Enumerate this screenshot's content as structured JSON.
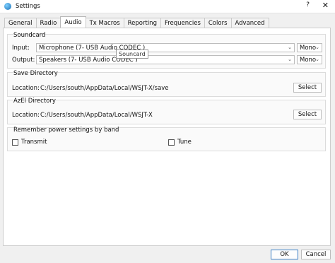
{
  "window": {
    "title": "Settings",
    "help": "?",
    "close": "✕"
  },
  "tabs": [
    {
      "label": "General"
    },
    {
      "label": "Radio"
    },
    {
      "label": "Audio"
    },
    {
      "label": "Tx Macros"
    },
    {
      "label": "Reporting"
    },
    {
      "label": "Frequencies"
    },
    {
      "label": "Colors"
    },
    {
      "label": "Advanced"
    }
  ],
  "active_tab": "Audio",
  "soundcard": {
    "title": "Soundcard",
    "input_label": "Input:",
    "input_value": "Microphone (7- USB Audio CODEC )",
    "input_channel": "Mono",
    "output_label": "Output:",
    "output_value": "Speakers (7- USB Audio CODEC )",
    "output_channel": "Mono",
    "tooltip": "Souncard"
  },
  "save_directory": {
    "title": "Save Directory",
    "location_label": "Location:",
    "path": "C:/Users/south/AppData/Local/WSJT-X/save",
    "select_label": "Select"
  },
  "azel_directory": {
    "title": "AzEl Directory",
    "location_label": "Location:",
    "path": "C:/Users/south/AppData/Local/WSJT-X",
    "select_label": "Select"
  },
  "power": {
    "title": "Remember power settings by band",
    "transmit_label": "Transmit",
    "tune_label": "Tune"
  },
  "footer": {
    "ok_label": "OK",
    "cancel_label": "Cancel"
  },
  "colors": {
    "accent": "#3b7fc5"
  }
}
